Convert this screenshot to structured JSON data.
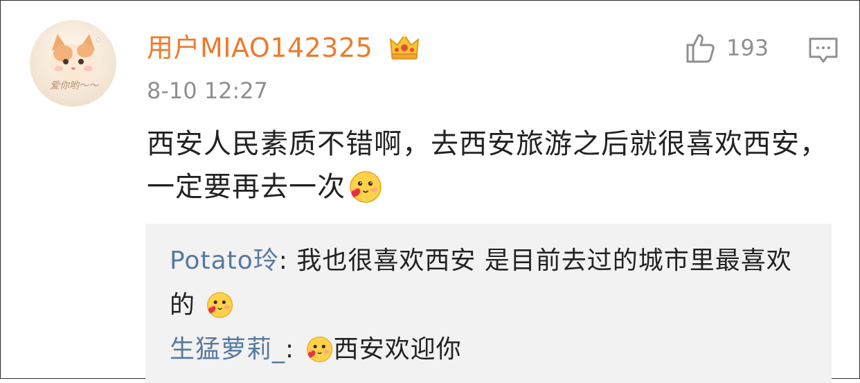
{
  "comment": {
    "username": "用户MIAO142325",
    "timestamp": "8-10 12:27",
    "like_count": "193",
    "body_text": "西安人民素质不错啊，去西安旅游之后就很喜欢西安，一定要再去一次",
    "badge_icon": "crown-badge-icon",
    "avatar_caption": "爱你哟～～"
  },
  "replies": [
    {
      "name": "Potato玲",
      "sep": ": ",
      "text": "我也很喜欢西安 是目前去过的城市里最喜欢的 ",
      "trailing_emoji": "blushing-heart-emoji"
    },
    {
      "name": "生猛萝莉_",
      "sep": ": ",
      "leading_emoji": "blushing-heart-emoji",
      "text": "西安欢迎你"
    }
  ],
  "icons": {
    "like": "thumbs-up-icon",
    "comment": "comment-bubble-icon"
  },
  "colors": {
    "username": "#ee7a2c",
    "reply_name": "#57799f",
    "meta_gray": "#8f8f8f",
    "reply_bg": "#f2f2f2"
  }
}
